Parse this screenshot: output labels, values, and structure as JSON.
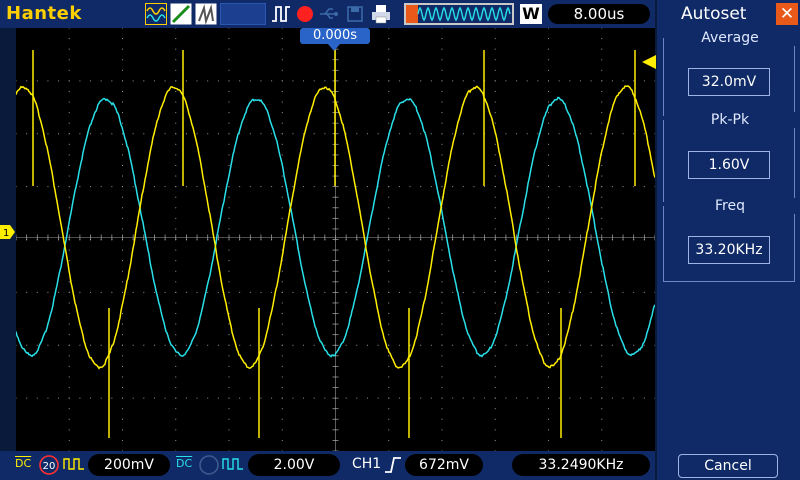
{
  "header": {
    "brand": "Hantek",
    "timebase": "8.00us",
    "window_mode": "W",
    "trigger_position": "0.000s"
  },
  "sidebar": {
    "title": "Autoset",
    "measurements": [
      {
        "label": "Average",
        "value": "32.0mV"
      },
      {
        "label": "Pk-Pk",
        "value": "1.60V"
      },
      {
        "label": "Freq",
        "value": "33.20KHz"
      }
    ],
    "cancel_label": "Cancel"
  },
  "footer": {
    "ch1": {
      "coupling": "DC",
      "probe": "20",
      "scale": "200mV"
    },
    "ch2": {
      "coupling": "DC",
      "scale": "2.00V"
    },
    "trigger": {
      "source": "CH1",
      "level": "672mV"
    },
    "frequency": "33.2490KHz"
  },
  "colors": {
    "ch1": "#ffee00",
    "ch2": "#29e0e8",
    "grid": "#9a9a9a",
    "panel": "#0f2a66"
  },
  "icons": {
    "close": "close-icon",
    "run_stop": "record-dot-icon",
    "usb": "usb-icon",
    "printer": "printer-icon"
  }
}
